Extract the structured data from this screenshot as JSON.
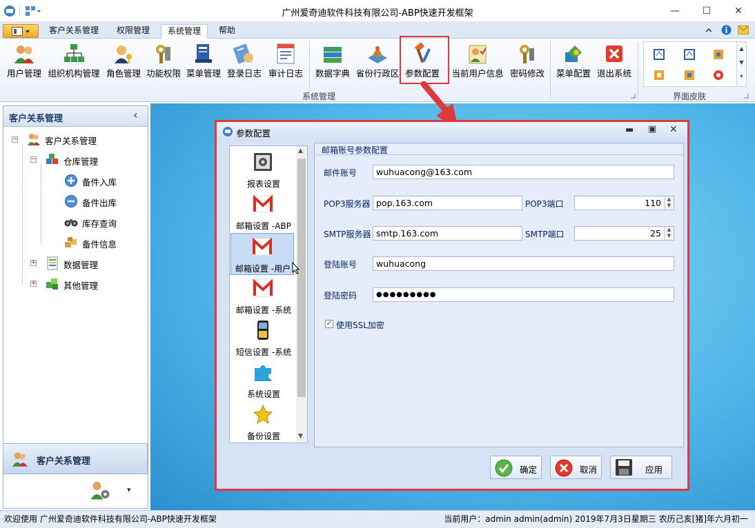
{
  "window": {
    "title": "广州爱奇迪软件科技有限公司-ABP快速开发框架",
    "min": "—",
    "max": "☐",
    "close": "✕"
  },
  "tabs": [
    "客户关系管理",
    "权限管理",
    "系统管理",
    "帮助"
  ],
  "ribbon": {
    "group1": "系统管理",
    "group2": "界面皮肤",
    "buttons": [
      "用户管理",
      "组织机构管理",
      "角色管理",
      "功能权限",
      "菜单管理",
      "登录日志",
      "审计日志",
      "数据字典",
      "省份行政区",
      "参数配置",
      "当前用户信息",
      "密码修改",
      "菜单配置",
      "退出系统"
    ]
  },
  "left": {
    "title": "客户关系管理",
    "collapse": "‹",
    "tree": {
      "root": "客户关系管理",
      "warehouse": "仓库管理",
      "in": "备件入库",
      "out": "备件出库",
      "query": "库存查询",
      "info": "备件信息",
      "data": "数据管理",
      "other": "其他管理"
    },
    "footer": "客户关系管理",
    "footer_arrow": "▾"
  },
  "dialog": {
    "title": "参数配置",
    "nav": [
      "报表设置",
      "邮箱设置 -ABP",
      "邮箱设置 -用户",
      "邮箱设置 -系统",
      "短信设置 -系统",
      "系统设置",
      "备份设置"
    ],
    "group": "邮箱账号参数配置",
    "fields": {
      "email_label": "邮件账号",
      "email": "wuhuacong@163.com",
      "pop3_label": "POP3服务器",
      "pop3": "pop.163.com",
      "pop3port_label": "POP3端口",
      "pop3port": "110",
      "smtp_label": "SMTP服务器",
      "smtp": "smtp.163.com",
      "smtpport_label": "SMTP端口",
      "smtpport": "25",
      "login_label": "登陆账号",
      "login": "wuhuacong",
      "pwd_label": "登陆密码",
      "pwd": "●●●●●●●●●",
      "ssl_label": "使用SSL加密"
    },
    "buttons": {
      "ok": "确定",
      "cancel": "取消",
      "apply": "应用"
    }
  },
  "status": {
    "left": "欢迎使用 广州爱奇迪软件科技有限公司-ABP快速开发框架",
    "right": "当前用户：admin admin(admin)  2019年7月3日星期三 农历己亥[猪]年六月初一"
  }
}
